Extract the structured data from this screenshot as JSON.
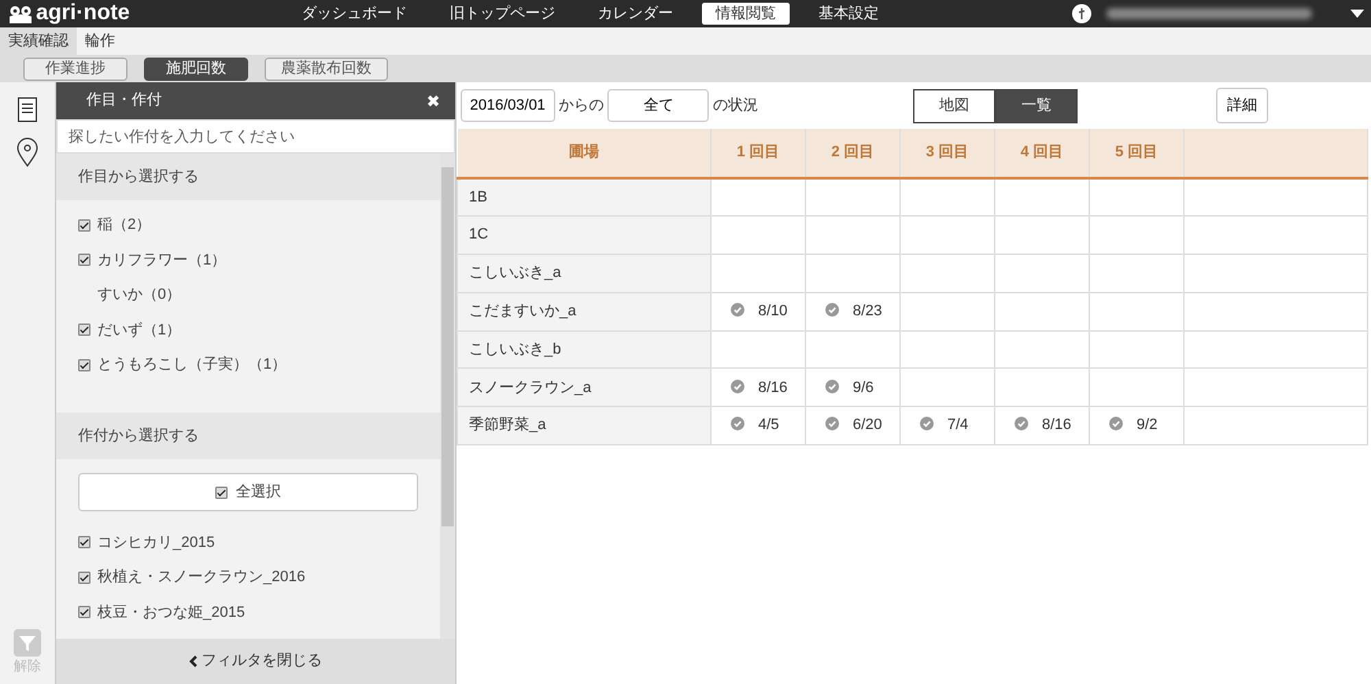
{
  "logo": {
    "text": "agri·note"
  },
  "nav": [
    {
      "label": "ダッシュボード",
      "selected": false
    },
    {
      "label": "旧トップページ",
      "selected": false
    },
    {
      "label": "カレンダー",
      "selected": false
    },
    {
      "label": "情報閲覧",
      "selected": true
    },
    {
      "label": "基本設定",
      "selected": false
    }
  ],
  "subnav": [
    {
      "label": "実績確認",
      "selected": true
    },
    {
      "label": "輪作",
      "selected": false
    }
  ],
  "tabs": [
    {
      "label": "作業進捗",
      "selected": false
    },
    {
      "label": "施肥回数",
      "selected": true
    },
    {
      "label": "農薬散布回数",
      "selected": false
    }
  ],
  "filter": {
    "title": "作目・作付",
    "close": "✖",
    "search": {
      "placeholder": "探したい作付を入力してください"
    },
    "crop_section": "作目から選択する",
    "crops": [
      {
        "label": "稲（2）",
        "checked": true
      },
      {
        "label": "カリフラワー（1）",
        "checked": true
      },
      {
        "label": "すいか（0）",
        "checked": false
      },
      {
        "label": "だいず（1）",
        "checked": true
      },
      {
        "label": "とうもろこし（子実）（1）",
        "checked": true
      }
    ],
    "planting_section": "作付から選択する",
    "select_all": {
      "label": "全選択",
      "checked": true
    },
    "plantings": [
      {
        "label": "コシヒカリ_2015",
        "checked": true
      },
      {
        "label": "秋植え・スノークラウン_2016",
        "checked": true
      },
      {
        "label": "枝豆・おつな姫_2015",
        "checked": true
      }
    ],
    "close_button": "フィルタを閉じる"
  },
  "rail": {
    "clear_label": "解除"
  },
  "toolbar": {
    "date": "2016/03/01",
    "from": "からの",
    "scope": "全て",
    "status": "の状況",
    "views": [
      {
        "label": "地図",
        "selected": false
      },
      {
        "label": "一覧",
        "selected": true
      }
    ],
    "detail": "詳細"
  },
  "table": {
    "columns": [
      "圃場",
      "1 回目",
      "2 回目",
      "3 回目",
      "4 回目",
      "5 回目"
    ],
    "rows": [
      {
        "field": "1B",
        "dates": []
      },
      {
        "field": "1C",
        "dates": []
      },
      {
        "field": "こしいぶき_a",
        "dates": []
      },
      {
        "field": "こだますいか_a",
        "dates": [
          "8/10",
          "8/23"
        ]
      },
      {
        "field": "こしいぶき_b",
        "dates": []
      },
      {
        "field": "スノークラウン_a",
        "dates": [
          "8/16",
          "9/6"
        ]
      },
      {
        "field": "季節野菜_a",
        "dates": [
          "4/5",
          "6/20",
          "7/4",
          "8/16",
          "9/2"
        ]
      }
    ]
  }
}
